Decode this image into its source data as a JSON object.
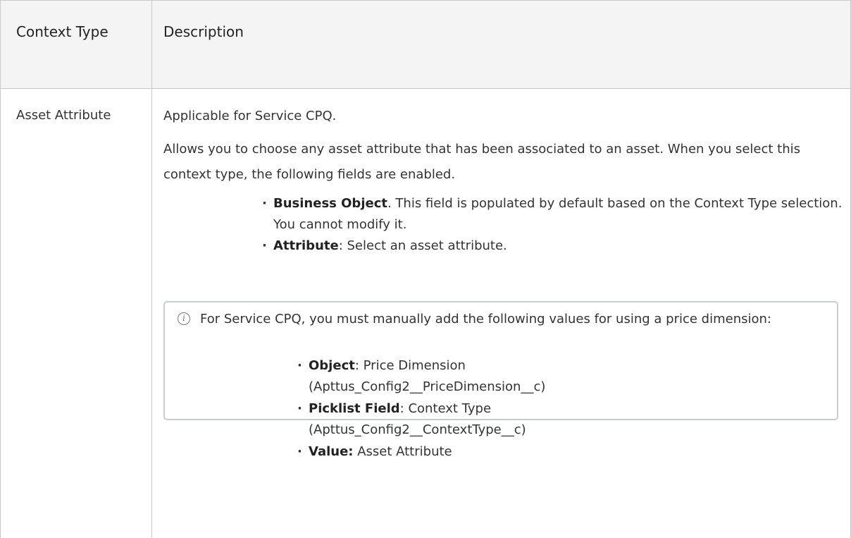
{
  "table": {
    "header": {
      "context_type": "Context Type",
      "description": "Description"
    },
    "row": {
      "context_type": "Asset Attribute",
      "applicable": "Applicable for Service CPQ.",
      "allows": "Allows you to choose any asset attribute that has been associated to an asset. When you select this context type, the following fields are enabled.",
      "bullets": [
        {
          "label": "Business Object",
          "text": ". This field is populated by default based on the Context Type selection. You cannot modify it."
        },
        {
          "label": "Attribute",
          "text": ": Select an asset attribute."
        }
      ],
      "note": {
        "icon": "info-icon",
        "text": "For Service CPQ, you must manually add the following values for using a price dimension:",
        "items": [
          {
            "label": "Object",
            "text": ": Price Dimension",
            "cont": "(Apttus_Config2__PriceDimension__c)"
          },
          {
            "label": "Picklist Field",
            "text": ": Context Type",
            "cont": "(Apttus_Config2__ContextType__c)"
          },
          {
            "label": "Value:",
            "text": " Asset Attribute",
            "cont": ""
          }
        ]
      }
    }
  }
}
